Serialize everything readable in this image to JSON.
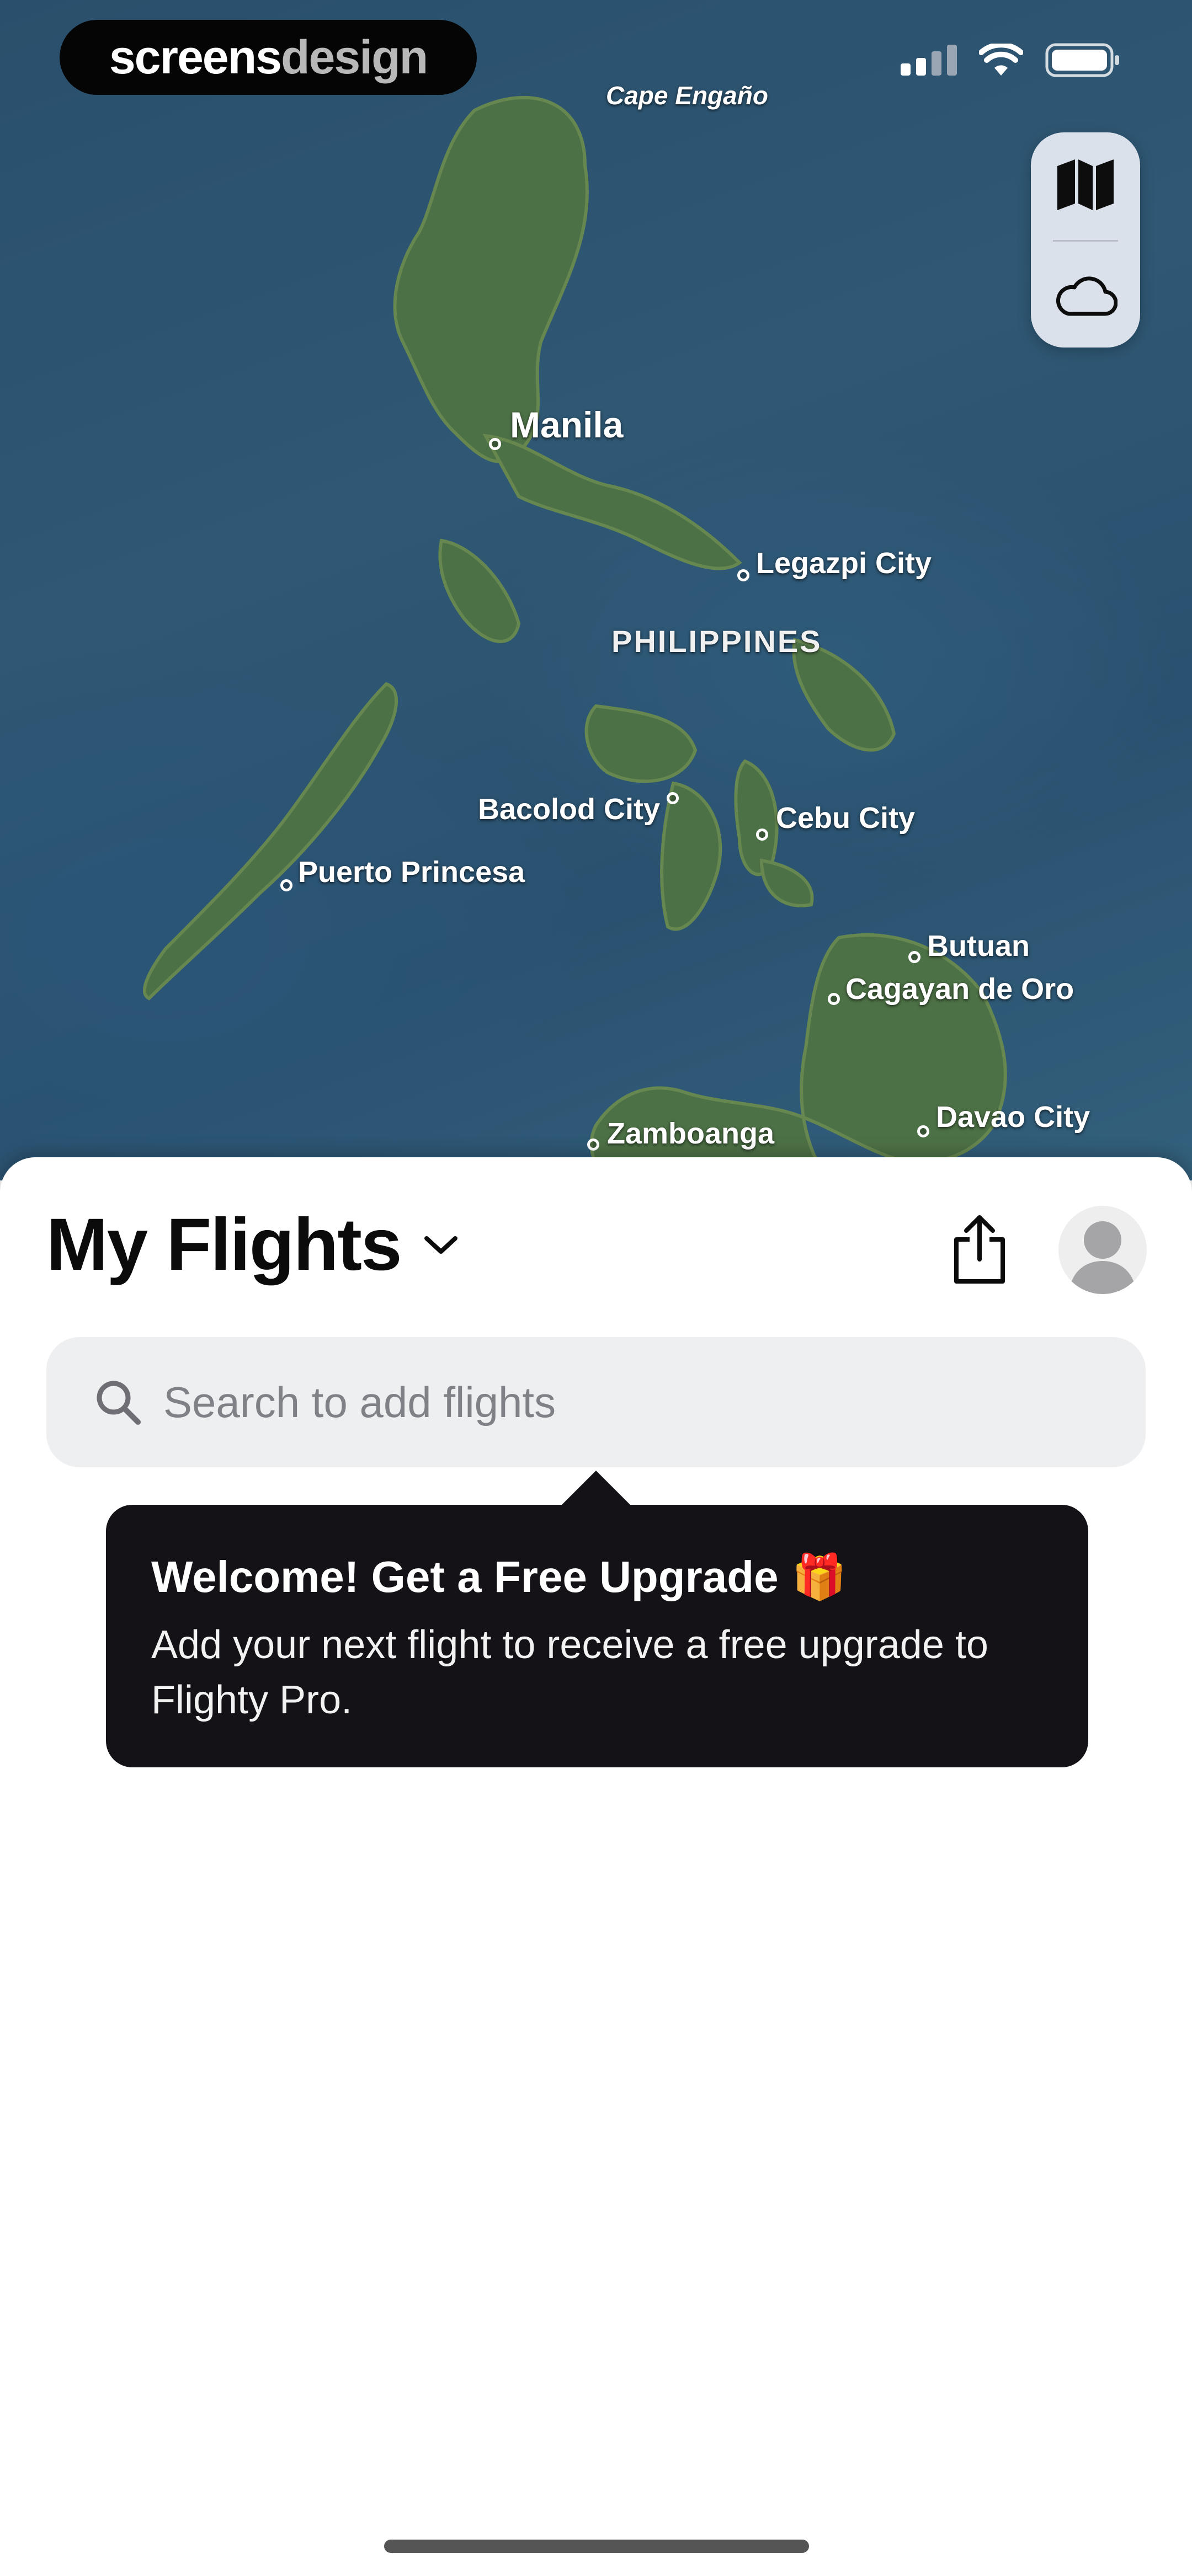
{
  "brand": {
    "part1": "screens",
    "part2": "design"
  },
  "map": {
    "cities": [
      {
        "id": "cape-engano",
        "label": "Cape Engaño"
      },
      {
        "id": "manila",
        "label": "Manila"
      },
      {
        "id": "legazpi",
        "label": "Legazpi City"
      },
      {
        "id": "bacolod",
        "label": "Bacolod City"
      },
      {
        "id": "cebu",
        "label": "Cebu City"
      },
      {
        "id": "puerto-princesa",
        "label": "Puerto Princesa"
      },
      {
        "id": "butuan",
        "label": "Butuan"
      },
      {
        "id": "cagayan",
        "label": "Cagayan de Oro"
      },
      {
        "id": "zamboanga",
        "label": "Zamboanga"
      },
      {
        "id": "davao",
        "label": "Davao City"
      }
    ],
    "country": "PHILIPPINES",
    "controls": {
      "map_icon": "map-icon",
      "weather_icon": "cloud-icon"
    }
  },
  "sheet": {
    "title": "My Flights",
    "search_placeholder": "Search to add flights"
  },
  "tooltip": {
    "heading": "Welcome! Get a Free Upgrade",
    "emoji": "🎁",
    "body": "Add your next flight to receive a free upgrade to Flighty Pro."
  },
  "colors": {
    "tooltip_bg": "#141216",
    "search_bg": "#eeeff1",
    "brand_bg": "#050505"
  }
}
